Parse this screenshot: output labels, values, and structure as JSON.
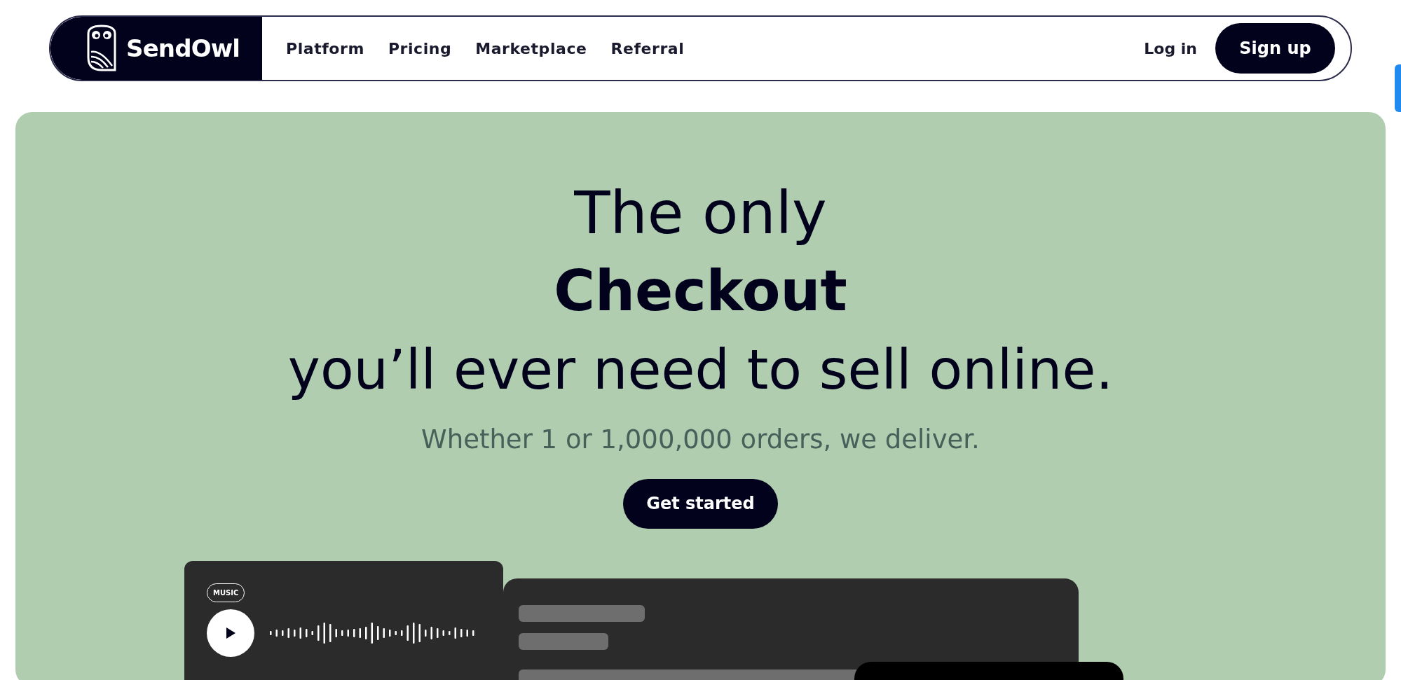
{
  "nav": {
    "brand": "SendOwl",
    "links": [
      "Platform",
      "Pricing",
      "Marketplace",
      "Referral"
    ],
    "login": "Log in",
    "signup": "Sign up"
  },
  "hero": {
    "line_1": "The only",
    "line_2": "Checkout",
    "line_3": "you’ll ever need to sell online.",
    "subtitle": "Whether 1 or 1,000,000 orders, we deliver.",
    "cta": "Get started"
  },
  "music_card": {
    "tag": "MUSIC"
  }
}
